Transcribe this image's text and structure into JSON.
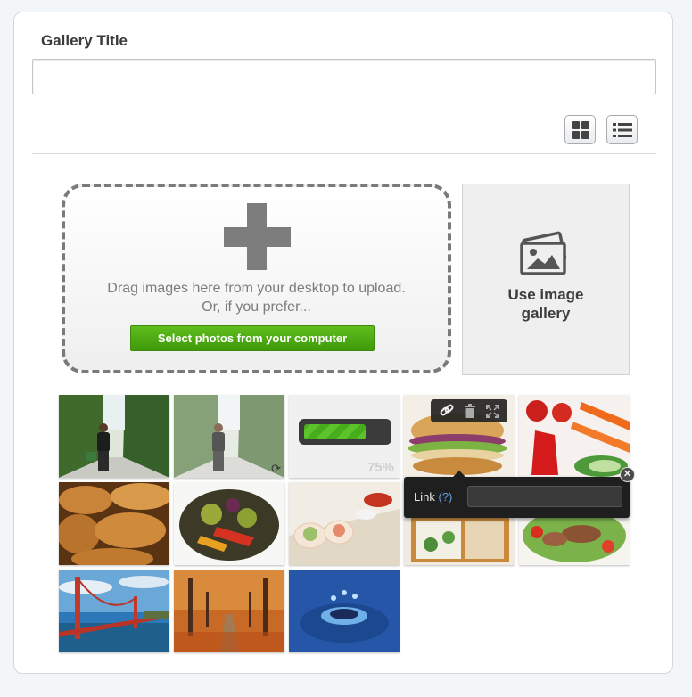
{
  "form": {
    "title_label": "Gallery Title",
    "title_value": "",
    "title_placeholder": ""
  },
  "view_toggle": {
    "grid_icon": "grid-view-icon",
    "list_icon": "list-view-icon"
  },
  "dropzone": {
    "icon": "plus-icon",
    "line1": "Drag images here from your desktop to upload.",
    "line2": "Or, if you prefer...",
    "button_label": "Select photos from your computer"
  },
  "gallery_option": {
    "icon": "image-gallery-icon",
    "label_line1": "Use image",
    "label_line2": "gallery"
  },
  "thumbnails": {
    "items": [
      {
        "subject": "man in hedge garden path"
      },
      {
        "subject": "man in hedge garden path (processing)",
        "status_icon": "refresh-icon"
      },
      {
        "subject": "uploading",
        "progress_percent": 75,
        "progress_label": "75%"
      },
      {
        "subject": "sandwich"
      },
      {
        "subject": "tomatoes, carrots and cucumber"
      },
      {
        "subject": "bread loaves"
      },
      {
        "subject": "grilled vegetables"
      },
      {
        "subject": "spring rolls"
      },
      {
        "subject": "bento box"
      },
      {
        "subject": "beef salad"
      },
      {
        "subject": "Golden Gate Bridge"
      },
      {
        "subject": "autumn tree avenue"
      },
      {
        "subject": "water drop splash"
      }
    ]
  },
  "tile_toolbar": {
    "icons": [
      "link-icon",
      "trash-icon",
      "fullscreen-icon"
    ]
  },
  "link_popover": {
    "label": "Link",
    "help": "(?)",
    "value": "",
    "close_icon": "close-icon"
  },
  "colors": {
    "accent_green": "#4aa812",
    "background": "#f3f6f9",
    "link_blue": "#5b9fe0"
  }
}
